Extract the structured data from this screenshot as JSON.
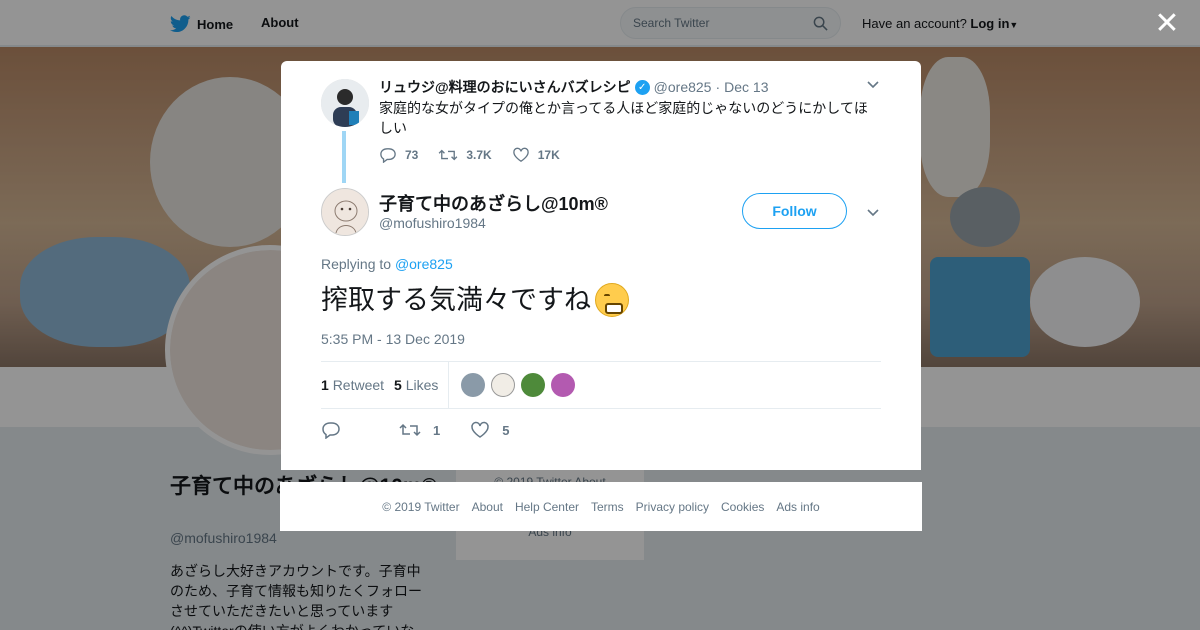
{
  "topbar": {
    "home_label": "Home",
    "about_label": "About",
    "search_placeholder": "Search Twitter",
    "have_account": "Have an account?",
    "login_label": "Log in"
  },
  "profile": {
    "name": "子育て中のあざらし@10m®",
    "handle": "@mofushiro1984",
    "bio": "あざらし大好きアカウントです。子育中のため、子育て情報も知りたくフォローさせていただきたいと思っています (^^)Twitterの使い方がよくわかっていな",
    "side_card_line1": "© 2019 Twitter   About",
    "side_card_line2": "Ads info"
  },
  "parent_tweet": {
    "name": "リュウジ@料理のおにいさんバズレシピ",
    "handle": "@ore825",
    "date": "Dec 13",
    "text": "家庭的な女がタイプの俺とか言ってる人ほど家庭的じゃないのどうにかしてほしい",
    "reply_count": "73",
    "retweet_count": "3.7K",
    "like_count": "17K"
  },
  "tweet": {
    "name": "子育て中のあざらし@10m®",
    "handle": "@mofushiro1984",
    "follow_label": "Follow",
    "replying_to_label": "Replying to",
    "replying_to_handle": "@ore825",
    "text": "搾取する気満々ですね",
    "time": "5:35 PM - 13 Dec 2019",
    "retweets_count": "1",
    "retweets_label": "Retweet",
    "likes_count": "5",
    "likes_label": "Likes",
    "action_retweets": "1",
    "action_likes": "5"
  },
  "likers": [
    {
      "color": "#8a9aa8"
    },
    {
      "color": "#f1ede6"
    },
    {
      "color": "#4e8a3a"
    },
    {
      "color": "#b35ab0"
    }
  ],
  "footer": {
    "links": [
      "© 2019 Twitter",
      "About",
      "Help Center",
      "Terms",
      "Privacy policy",
      "Cookies",
      "Ads info"
    ]
  },
  "colors": {
    "accent": "#1da1f2",
    "secondary_text": "#657786"
  }
}
